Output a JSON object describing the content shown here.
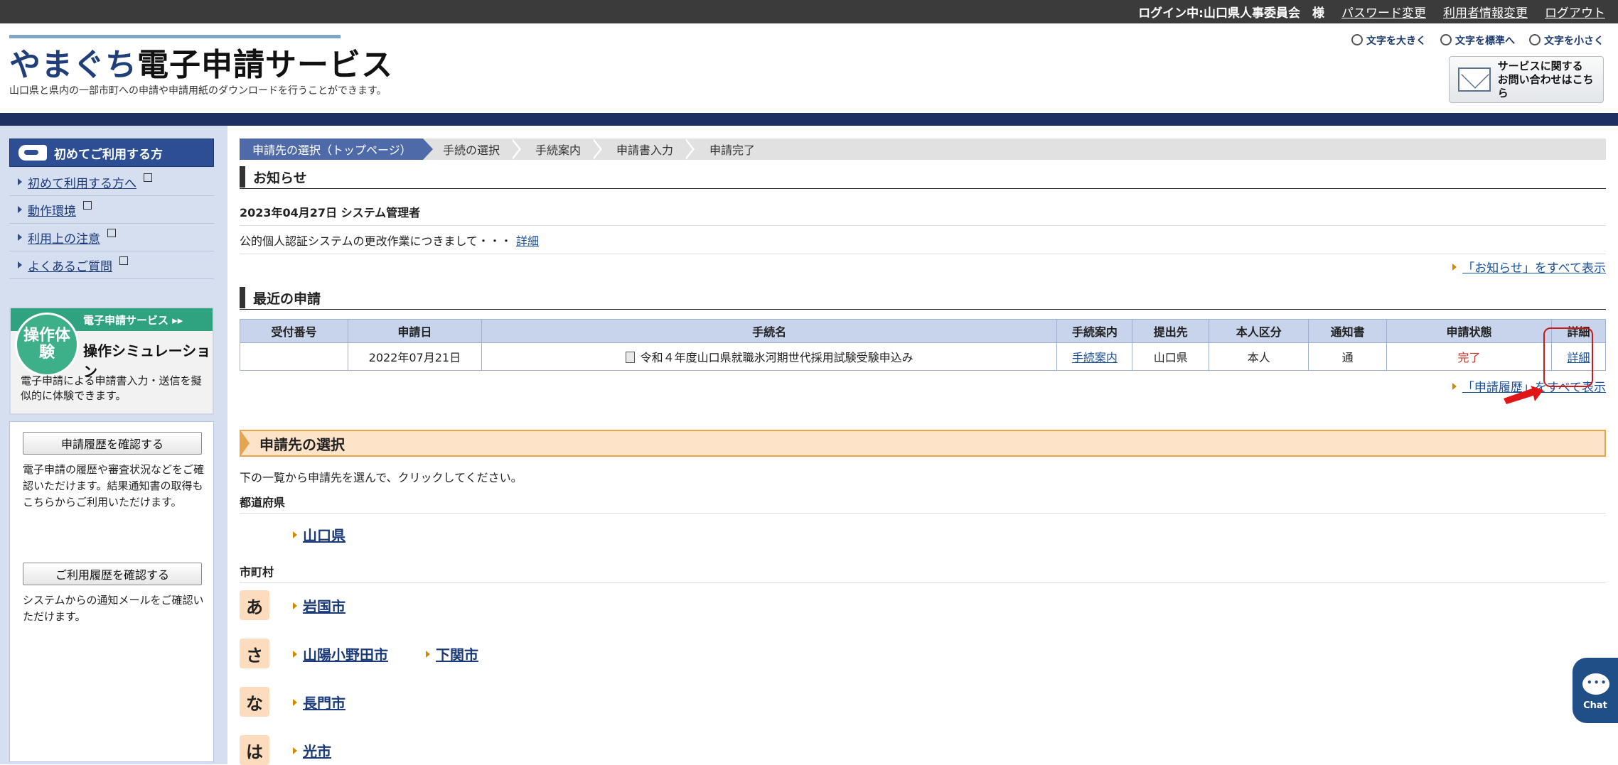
{
  "topbar": {
    "login_status": "ログイン中:山口県人事委員会　様",
    "links": [
      "パスワード変更",
      "利用者情報変更",
      "ログアウト"
    ]
  },
  "header": {
    "logo_hira": "やまぐち",
    "logo_main": "電子申請サービス",
    "tagline": "山口県と県内の一部市町への申請や申請用紙のダウンロードを行うことができます。",
    "font_size_controls": [
      "文字を大きく",
      "文字を標準へ",
      "文字を小さく"
    ],
    "contact_line1": "サービスに関する",
    "contact_line2": "お問い合わせはこちら"
  },
  "sidebar": {
    "first_time_heading": "初めてご利用する方",
    "links": [
      "初めて利用する方へ",
      "動作環境",
      "利用上の注意",
      "よくあるご質問"
    ],
    "simulation": {
      "badge": "操作体験",
      "service_label": "電子申請サービス ▸▸",
      "title": "操作シミュレーション",
      "description": "電子申請による申請書入力・送信を擬似的に体験できます。"
    },
    "history_button": "申請履歴を確認する",
    "history_desc": "電子申請の履歴や審査状況などをご確認いただけます。結果通知書の取得もこちらからご利用いただけます。",
    "usage_button": "ご利用履歴を確認する",
    "usage_desc": "システムからの通知メールをご確認いただけます。"
  },
  "steps": [
    "申請先の選択（トップページ）",
    "手続の選択",
    "手続案内",
    "申請書入力",
    "申請完了"
  ],
  "news": {
    "heading": "お知らせ",
    "date_author": "2023年04月27日 システム管理者",
    "body": "公的個人認証システムの更改作業につきまして・・・",
    "detail_link": "詳細",
    "show_all": "「お知らせ」をすべて表示"
  },
  "recent": {
    "heading": "最近の申請",
    "columns": [
      "受付番号",
      "申請日",
      "手続名",
      "手続案内",
      "提出先",
      "本人区分",
      "通知書",
      "申請状態",
      "詳細"
    ],
    "rows": [
      {
        "receipt_no": "",
        "date": "2022年07月21日",
        "procedure": "令和４年度山口県就職氷河期世代採用試験受験申込み",
        "guide_link": "手続案内",
        "destination": "山口県",
        "person": "本人",
        "notice": "通",
        "status": "完了",
        "detail_link": "詳細"
      }
    ],
    "show_all": "「申請履歴」をすべて表示"
  },
  "selection": {
    "heading": "申請先の選択",
    "description": "下の一覧から申請先を選んで、クリックしてください。",
    "prefecture_label": "都道府県",
    "prefecture": "山口県",
    "municipality_label": "市町村",
    "groups": [
      {
        "kana": "あ",
        "items": [
          "岩国市"
        ]
      },
      {
        "kana": "さ",
        "items": [
          "山陽小野田市",
          "下関市"
        ]
      },
      {
        "kana": "な",
        "items": [
          "長門市"
        ]
      },
      {
        "kana": "は",
        "items": [
          "光市"
        ]
      }
    ]
  },
  "chat": {
    "label": "Chat"
  },
  "colors": {
    "navy": "#1e2f63",
    "step_active": "#4f6aa8",
    "table_header": "#c8d4ec",
    "selection_bg": "#fde3c8",
    "status_done": "#c0392b"
  }
}
